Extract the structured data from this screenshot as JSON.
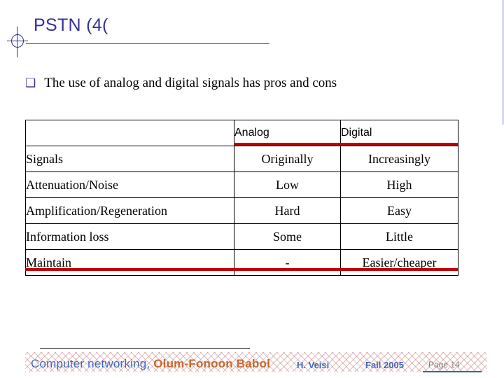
{
  "slide": {
    "title": "PSTN (4(",
    "bullet": {
      "marker": "❑",
      "text": "The use of analog and digital signals has pros and cons"
    },
    "table": {
      "headers": [
        "",
        "Analog",
        "Digital"
      ],
      "rows": [
        {
          "label": "Signals",
          "analog": "Originally",
          "digital": "Increasingly"
        },
        {
          "label": "Attenuation/Noise",
          "analog": "Low",
          "digital": "High"
        },
        {
          "label": "Amplification/Regeneration",
          "analog": "Hard",
          "digital": "Easy"
        },
        {
          "label": "Information loss",
          "analog": "Some",
          "digital": "Little"
        },
        {
          "label": "Maintain",
          "analog": "-",
          "digital": "Easier/cheaper"
        }
      ]
    },
    "footer": {
      "course": "Computer networking,",
      "org": "Olum-Fonoon Babol",
      "author": "H. Veisi",
      "term": "Fall 2005",
      "page": "Page 14"
    },
    "colors": {
      "title": "#333399",
      "rule": "#8a3b3b",
      "accent_red": "#c00000",
      "footer_blue": "#2a63c8",
      "footer_orange": "#c8641e"
    }
  }
}
